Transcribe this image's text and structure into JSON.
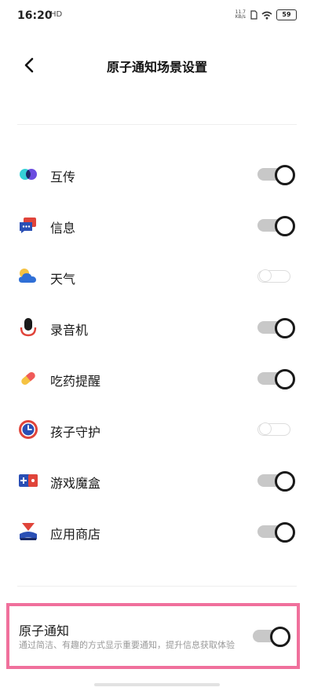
{
  "status_bar": {
    "time": "16:20",
    "hd": "HD",
    "net_speed_value": "11.7",
    "net_speed_unit": "KB/s",
    "battery": "59"
  },
  "header": {
    "title": "原子通知场景设置",
    "back_icon": "chevron-left-icon"
  },
  "scenes": [
    {
      "label": "互传",
      "icon": "transfer-icon",
      "enabled": true
    },
    {
      "label": "信息",
      "icon": "messages-icon",
      "enabled": true
    },
    {
      "label": "天气",
      "icon": "weather-icon",
      "enabled": false
    },
    {
      "label": "录音机",
      "icon": "microphone-icon",
      "enabled": true
    },
    {
      "label": "吃药提醒",
      "icon": "pill-icon",
      "enabled": true
    },
    {
      "label": "孩子守护",
      "icon": "clock-shield-icon",
      "enabled": false
    },
    {
      "label": "游戏魔盒",
      "icon": "game-box-icon",
      "enabled": true
    },
    {
      "label": "应用商店",
      "icon": "app-store-icon",
      "enabled": true
    }
  ],
  "atomic": {
    "title": "原子通知",
    "description": "通过简洁、有趣的方式显示重要通知，提升信息获取体验",
    "enabled": true
  },
  "colors": {
    "highlight_border": "#f0709c",
    "toggle_on_track": "#c8c8c8",
    "text_secondary": "#999999"
  }
}
